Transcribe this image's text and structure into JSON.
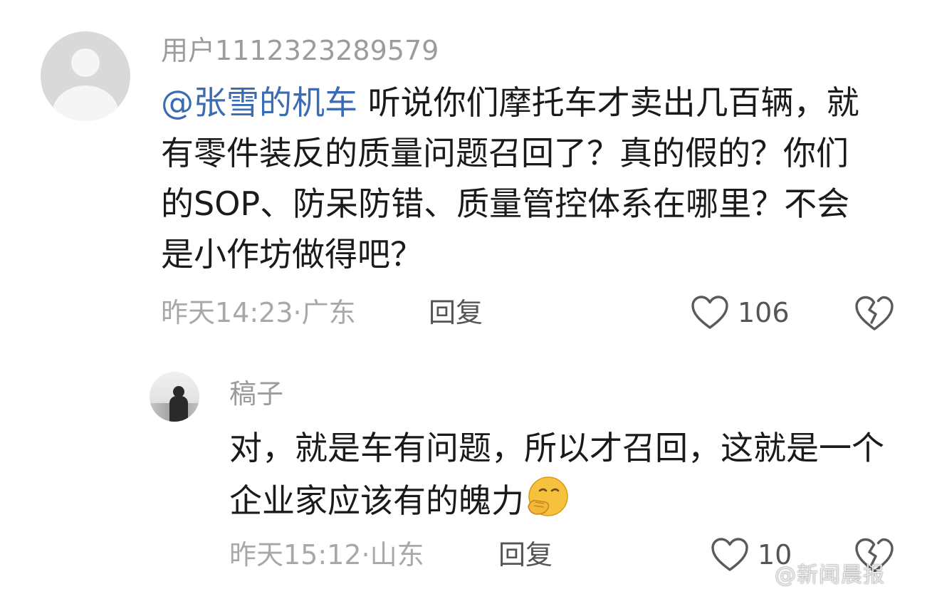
{
  "comment": {
    "username": "用户1112323289579",
    "mention": "@张雪的机车",
    "text": " 听说你们摩托车才卖出几百辆，就有零件装反的质量问题召回了？真的假的？你们的SOP、防呆防错、质量管控体系在哪里？不会是小作坊做得吧？",
    "meta": "昨天14:23·广东",
    "reply_label": "回复",
    "like_count": "106",
    "icons": {
      "like": "heart-outline-icon",
      "dislike": "broken-heart-icon"
    }
  },
  "reply": {
    "username": "稿子",
    "text": "对，就是车有问题，所以才召回，这就是一个企业家应该有的魄力",
    "emoji": "hand-over-mouth-smirk-emoji",
    "meta": "昨天15:12·山东",
    "reply_label": "回复",
    "like_count": "10",
    "icons": {
      "like": "heart-outline-icon",
      "dislike": "broken-heart-icon"
    }
  },
  "watermark": {
    "text": "@新闻晨报"
  }
}
